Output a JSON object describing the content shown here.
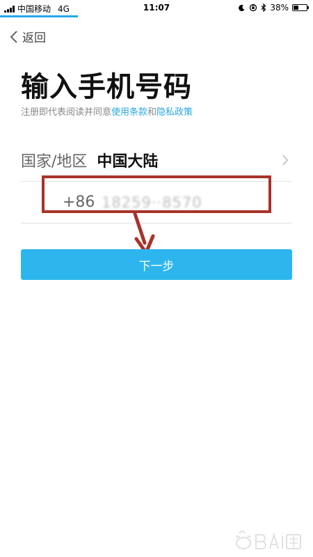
{
  "status_bar": {
    "carrier": "中国移动",
    "network": "4G",
    "time": "11:07",
    "battery_percent": "38%",
    "battery_level": 0.38
  },
  "nav": {
    "back_label": "返回"
  },
  "page": {
    "title": "输入手机号码",
    "terms_prefix": "注册即代表阅读并同意",
    "terms_link": "使用条款",
    "terms_and": "和",
    "privacy_link": "隐私政策"
  },
  "form": {
    "country_label": "国家/地区",
    "country_value": "中国大陆",
    "phone_prefix": "+86",
    "phone_value": "18259··8570"
  },
  "actions": {
    "next_label": "下一步"
  },
  "colors": {
    "accent": "#2db6ee",
    "link": "#28a8e0",
    "annotation": "#a8322a"
  }
}
